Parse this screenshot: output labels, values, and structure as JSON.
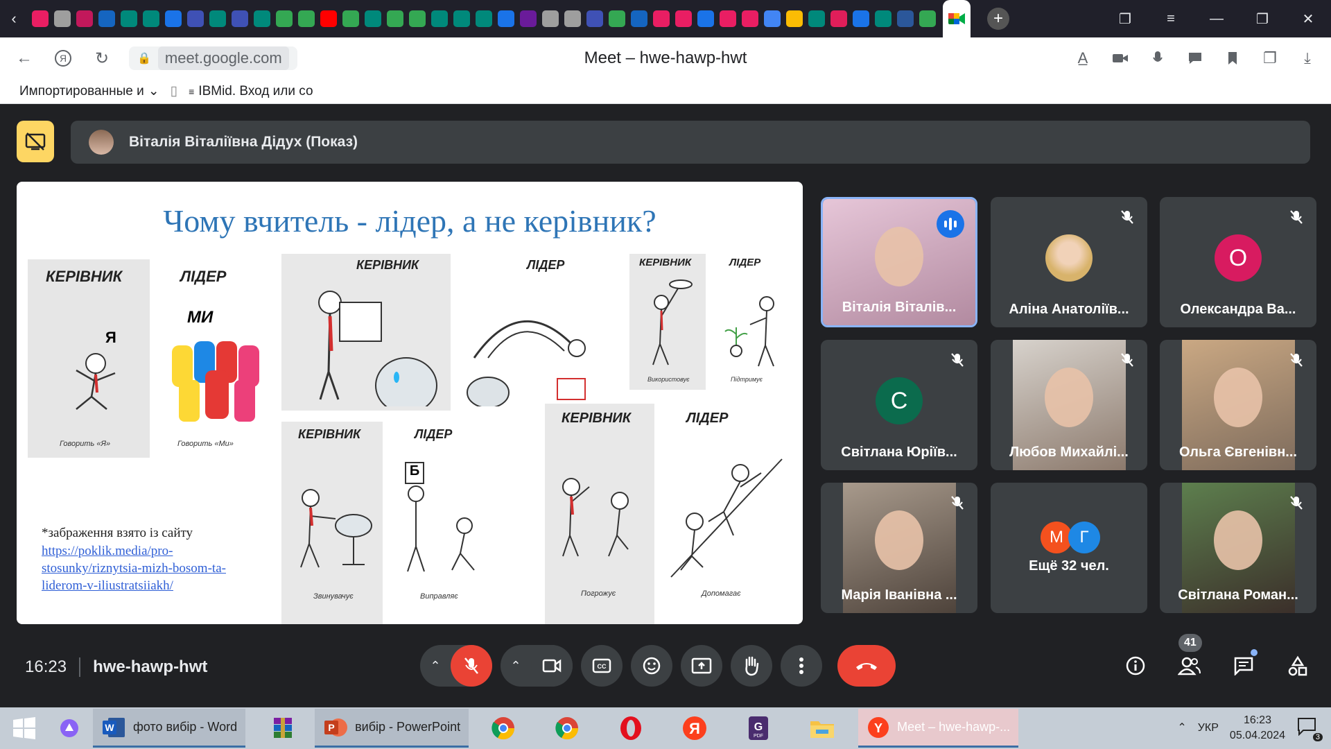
{
  "browser": {
    "page_title": "Meet – hwe-hawp-hwt",
    "url": "meet.google.com",
    "bookmarks": [
      {
        "label": "Импортированные и"
      },
      {
        "label": "IBMid. Вход или со"
      }
    ],
    "pinned_tab_colors": [
      "#e91e63",
      "#9e9e9e",
      "#c2185b",
      "#1565c0",
      "#00897b",
      "#00897b",
      "#1a73e8",
      "#3f51b5",
      "#00897b",
      "#3f51b5",
      "#00897b",
      "#34a853",
      "#34a853",
      "#ff0000",
      "#34a853",
      "#00897b",
      "#34a853",
      "#34a853",
      "#00897b",
      "#00897b",
      "#00897b",
      "#1a73e8",
      "#6a1b9a",
      "#9e9e9e",
      "#9e9e9e",
      "#3f51b5",
      "#34a853",
      "#1565c0",
      "#e91e63",
      "#e91e63",
      "#1a73e8",
      "#e91e63",
      "#e91e63",
      "#4285f4",
      "#fbbc04",
      "#00897b",
      "#e01e5a",
      "#1a73e8",
      "#00897b",
      "#2b579a",
      "#34a853"
    ]
  },
  "meet": {
    "presenter_banner": "Віталія Віталіївна Дідух (Показ)",
    "meeting_time": "16:23",
    "meeting_code": "hwe-hawp-hwt",
    "participants_count": "41",
    "slide": {
      "title": "Чому вчитель - лідер, а не керівник?",
      "source_text": "*забраження взято із сайту",
      "source_link": "https://poklik.media/pro-stosunky/riznytsia-mizh-bosom-ta-liderom-v-iliustratsiiakh/",
      "panels": [
        {
          "boss": "КЕРІВНИК",
          "leader": "ЛІДЕР",
          "boss_cap": "Говорить «Я»",
          "leader_cap": "Говорить «Ми»",
          "boss_word": "Я",
          "leader_word": "МИ"
        },
        {
          "boss": "КЕРІВНИК",
          "leader": "ЛІДЕР"
        },
        {
          "boss": "КЕРІВНИК",
          "leader": "ЛІДЕР",
          "boss_cap": "Використовує",
          "leader_cap": "Підтримує"
        },
        {
          "boss": "КЕРІВНИК",
          "leader": "ЛІДЕР",
          "boss_cap": "Звинувачує",
          "leader_cap": "Виправляє",
          "leader_sign": "Б"
        },
        {
          "boss": "КЕРІВНИК",
          "leader": "ЛІДЕР",
          "boss_cap": "Погрожує",
          "leader_cap": "Допомагає"
        }
      ]
    },
    "tiles": [
      {
        "name": "Віталія Віталів...",
        "type": "video",
        "speaking": true
      },
      {
        "name": "Аліна Анатоліїв...",
        "type": "photo",
        "muted": true
      },
      {
        "name": "Олександра Ва...",
        "type": "letter",
        "letter": "О",
        "color": "#d81b60",
        "muted": true
      },
      {
        "name": "Світлана Юріїв...",
        "type": "letter",
        "letter": "С",
        "color": "#0b6b4d",
        "muted": true
      },
      {
        "name": "Любов Михайлі...",
        "type": "video",
        "muted": true
      },
      {
        "name": "Ольга Євгенівн...",
        "type": "video",
        "muted": true
      },
      {
        "name": "Марія Іванівна ...",
        "type": "video",
        "muted": true
      },
      {
        "name": "Ещё 32 чел.",
        "type": "more",
        "letters": [
          "М",
          "Г"
        ],
        "colors": [
          "#f4511e",
          "#1e88e5"
        ]
      },
      {
        "name": "Світлана Роман...",
        "type": "video",
        "muted": true
      }
    ]
  },
  "taskbar": {
    "apps": [
      {
        "label": "фото вибір - Word"
      },
      {
        "label": "вибір - PowerPoint"
      },
      {
        "label": "Meet – hwe-hawp-..."
      }
    ],
    "tray_lang": "УКР",
    "tray_time": "16:23",
    "tray_date": "05.04.2024",
    "notif_count": "3"
  }
}
